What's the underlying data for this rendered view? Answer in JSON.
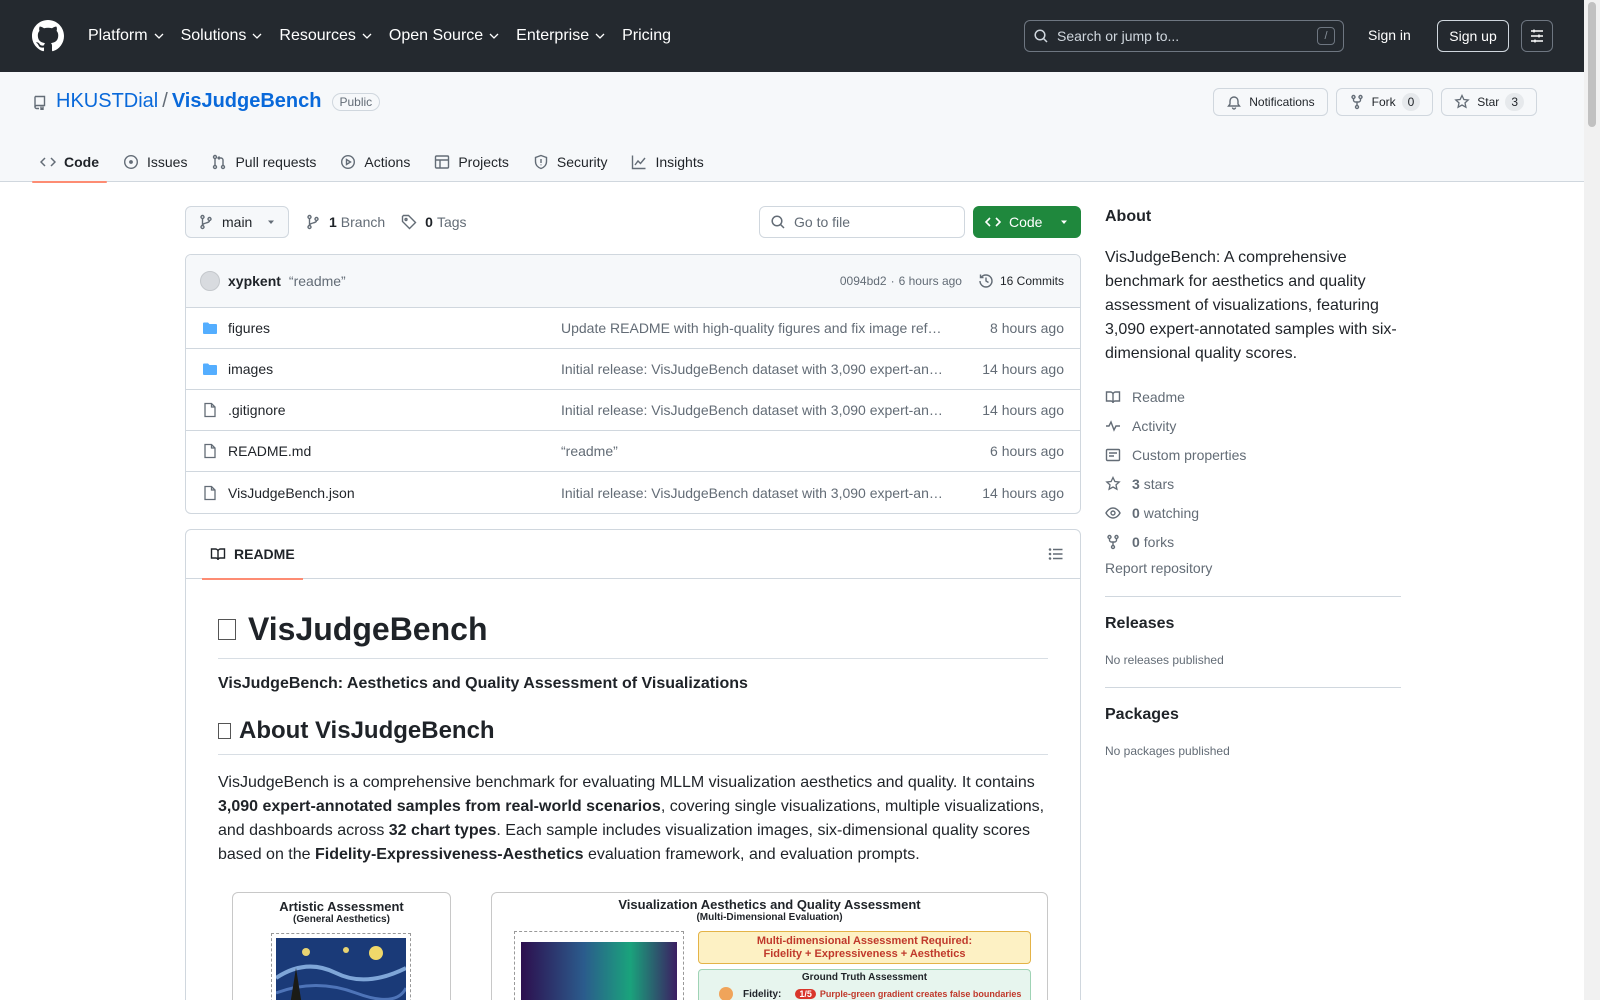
{
  "header": {
    "nav": [
      "Platform",
      "Solutions",
      "Resources",
      "Open Source",
      "Enterprise",
      "Pricing"
    ],
    "search_placeholder": "Search or jump to...",
    "search_key": "/",
    "sign_in": "Sign in",
    "sign_up": "Sign up"
  },
  "repo": {
    "owner": "HKUSTDial",
    "separator": "/",
    "name": "VisJudgeBench",
    "visibility": "Public",
    "actions": {
      "notifications": "Notifications",
      "fork": "Fork",
      "fork_count": "0",
      "star": "Star",
      "star_count": "3"
    },
    "tabs": [
      "Code",
      "Issues",
      "Pull requests",
      "Actions",
      "Projects",
      "Security",
      "Insights"
    ]
  },
  "branch_bar": {
    "branch": "main",
    "branch_count": "1",
    "branch_label": "Branch",
    "tag_count": "0",
    "tag_label": "Tags",
    "goto_placeholder": "Go to file",
    "code_button": "Code"
  },
  "latest_commit": {
    "author": "xypkent",
    "message": "“readme”",
    "hash": "0094bd2",
    "dot": "·",
    "age": "6 hours ago",
    "commits": "16 Commits"
  },
  "files": [
    {
      "name": "figures",
      "type": "folder",
      "commit": "Update README with high-quality figures and fix image ref…",
      "age": "8 hours ago"
    },
    {
      "name": "images",
      "type": "folder",
      "commit": "Initial release: VisJudgeBench dataset with 3,090 expert-an…",
      "age": "14 hours ago"
    },
    {
      "name": ".gitignore",
      "type": "file",
      "commit": "Initial release: VisJudgeBench dataset with 3,090 expert-an…",
      "age": "14 hours ago"
    },
    {
      "name": "README.md",
      "type": "file",
      "commit": "“readme”",
      "age": "6 hours ago"
    },
    {
      "name": "VisJudgeBench.json",
      "type": "file",
      "commit": "Initial release: VisJudgeBench dataset with 3,090 expert-an…",
      "age": "14 hours ago"
    }
  ],
  "readme": {
    "tab": "README",
    "title": "VisJudgeBench",
    "subtitle": "VisJudgeBench: Aesthetics and Quality Assessment of Visualizations",
    "section_title": "About VisJudgeBench",
    "para": {
      "p1": "VisJudgeBench is a comprehensive benchmark for evaluating MLLM visualization aesthetics and quality. It contains ",
      "b1": "3,090 expert-annotated samples from real-world scenarios",
      "p2": ", covering single visualizations, multiple visualizations, and dashboards across ",
      "b2": "32 chart types",
      "p3": ". Each sample includes visualization images, six-dimensional quality scores based on the ",
      "b3": "Fidelity-Expressiveness-Aesthetics",
      "p4": " evaluation framework, and evaluation prompts."
    },
    "figure": {
      "left_title": "Artistic Assessment",
      "left_subtitle": "(General Aesthetics)",
      "right_title": "Visualization Aesthetics and Quality Assessment",
      "right_subtitle": "(Multi-Dimensional Evaluation)",
      "required_line1": "Multi-dimensional Assessment Required:",
      "required_line2": "Fidelity + Expressiveness + Aesthetics",
      "gt_title": "Ground Truth Assessment",
      "gt_label": "Fidelity:",
      "gt_score": "1/5",
      "gt_note": "Purple-green gradient creates false boundaries"
    }
  },
  "sidebar": {
    "about_title": "About",
    "description": "VisJudgeBench: A comprehensive benchmark for aesthetics and quality assessment of visualizations, featuring 3,090 expert-annotated samples with six-dimensional quality scores.",
    "links": {
      "readme": "Readme",
      "activity": "Activity",
      "custom_properties": "Custom properties",
      "stars_count": "3",
      "stars_label": "stars",
      "watching_count": "0",
      "watching_label": "watching",
      "forks_count": "0",
      "forks_label": "forks"
    },
    "report": "Report repository",
    "releases_title": "Releases",
    "releases_text": "No releases published",
    "packages_title": "Packages",
    "packages_text": "No packages published"
  },
  "colors": {
    "header_bg": "#24292f",
    "link": "#0969da",
    "code_button": "#1f883d",
    "active_tab": "#fd8c73",
    "folder": "#54aeff"
  }
}
